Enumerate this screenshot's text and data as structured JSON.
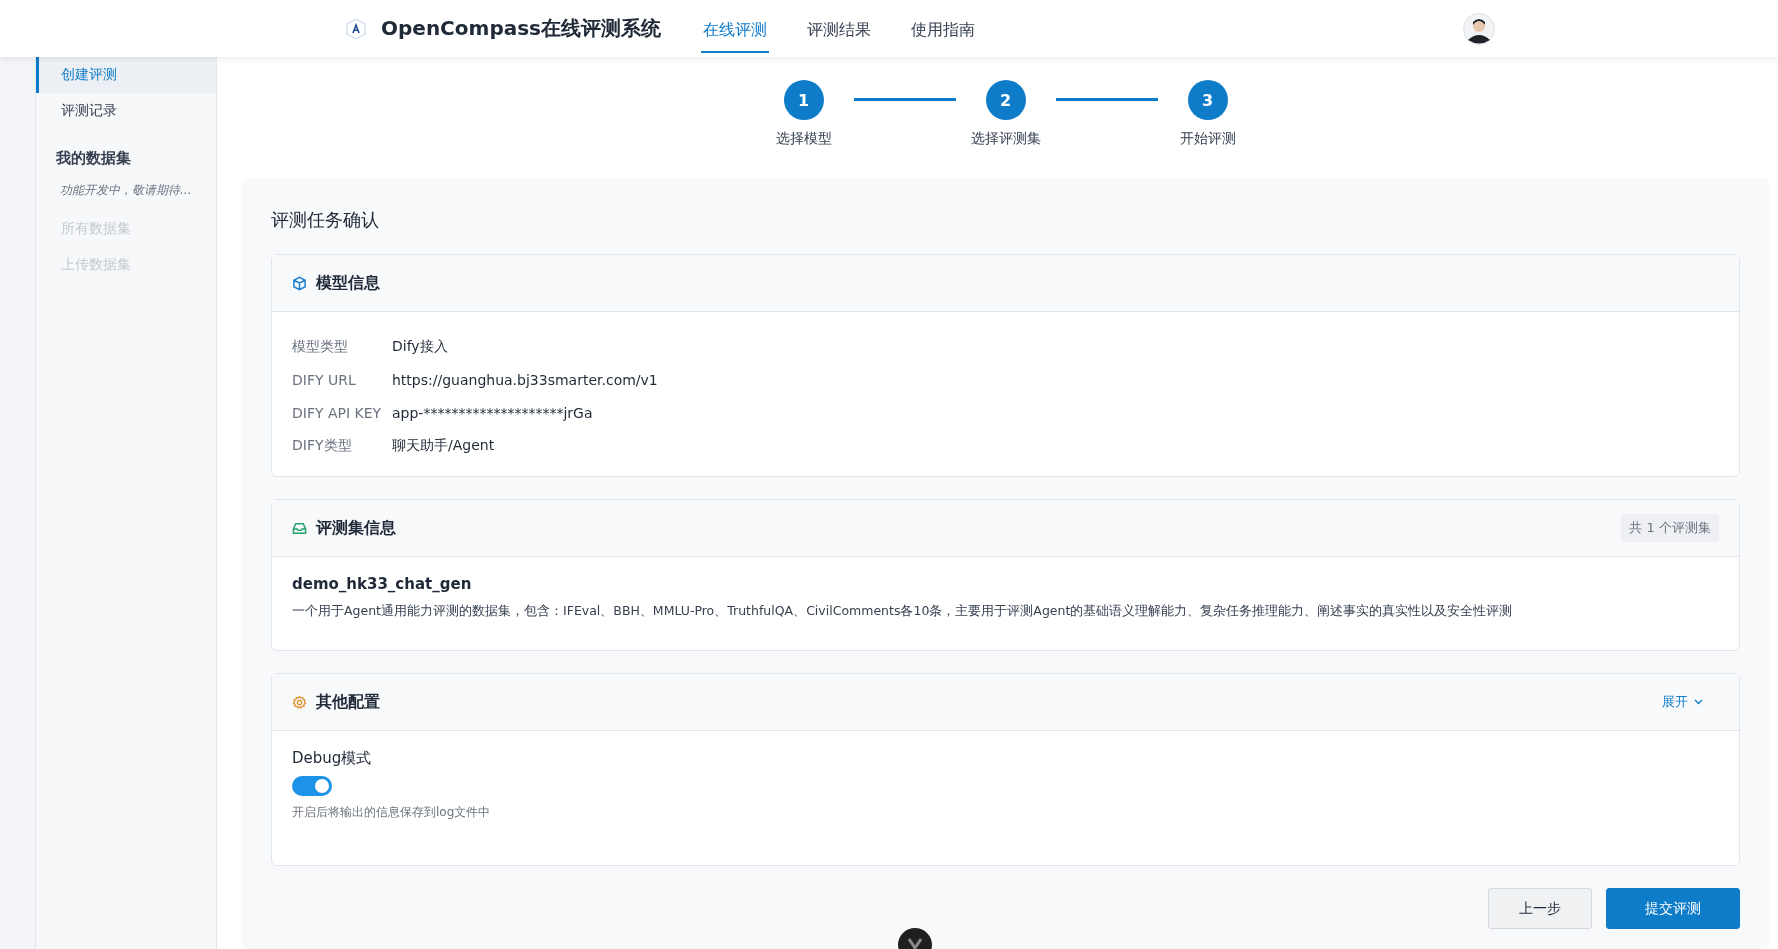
{
  "header": {
    "title": "OpenCompass在线评测系统",
    "nav": [
      {
        "label": "在线评测",
        "selected": true
      },
      {
        "label": "评测结果",
        "selected": false
      },
      {
        "label": "使用指南",
        "selected": false
      }
    ]
  },
  "sidebar": {
    "items": [
      {
        "label": "创建评测",
        "selected": true
      },
      {
        "label": "评测记录",
        "selected": false
      }
    ],
    "section": {
      "heading": "我的数据集",
      "note": "功能开发中，敬请期待...",
      "items": [
        {
          "label": "所有数据集",
          "disabled": true
        },
        {
          "label": "上传数据集",
          "disabled": true
        }
      ]
    }
  },
  "steps": [
    {
      "number": "1",
      "label": "选择模型"
    },
    {
      "number": "2",
      "label": "选择评测集"
    },
    {
      "number": "3",
      "label": "开始评测"
    }
  ],
  "panel_title": "评测任务确认",
  "model_card": {
    "title": "模型信息",
    "fields": [
      {
        "label": "模型类型",
        "value": "Dify接入"
      },
      {
        "label": "DIFY URL",
        "value": "https://guanghua.bj33smarter.com/v1"
      },
      {
        "label": "DIFY API KEY",
        "value": "app-********************jrGa"
      },
      {
        "label": "DIFY类型",
        "value": "聊天助手/Agent"
      }
    ]
  },
  "dataset_card": {
    "title": "评测集信息",
    "count_badge": "共 1 个评测集",
    "datasets": [
      {
        "name": "demo_hk33_chat_gen",
        "description": "一个用于Agent通用能力评测的数据集，包含：IFEval、BBH、MMLU-Pro、TruthfulQA、CivilComments各10条，主要用于评测Agent的基础语义理解能力、复杂任务推理能力、阐述事实的真实性以及安全性评测"
      }
    ]
  },
  "config_card": {
    "title": "其他配置",
    "expand_link": "展开",
    "settings": [
      {
        "label": "Debug模式",
        "on": true,
        "hint": "开启后将输出的信息保存到log文件中"
      }
    ]
  },
  "buttons": {
    "back": "上一步",
    "submit": "提交评测"
  }
}
